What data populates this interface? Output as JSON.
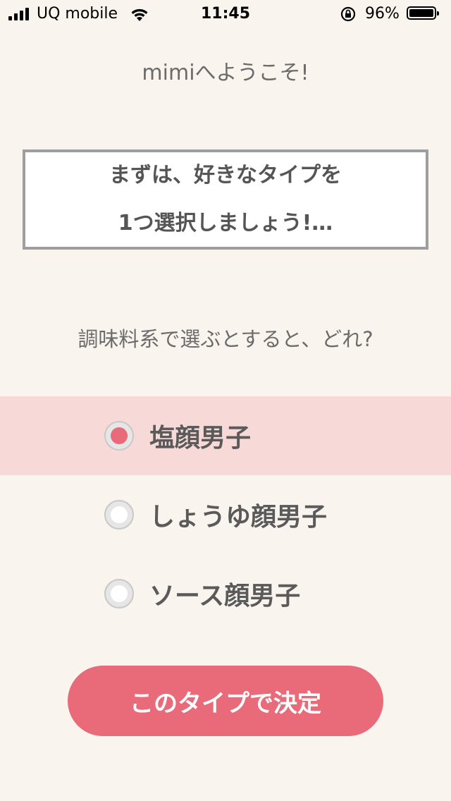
{
  "status_bar": {
    "carrier": "UQ mobile",
    "time": "11:45",
    "battery_percent": "96%",
    "icons": [
      "signal-icon",
      "wifi-icon",
      "rotation-lock-icon",
      "battery-icon"
    ]
  },
  "welcome_text": "mimiへようこそ!",
  "intro": {
    "line1": "まずは、好きなタイプを",
    "line2": "1つ選択しましょう!…"
  },
  "question": "調味料系で選ぶとすると、どれ?",
  "options": [
    {
      "label": "塩顔男子",
      "selected": true
    },
    {
      "label": "しょうゆ顔男子",
      "selected": false
    },
    {
      "label": "ソース顔男子",
      "selected": false
    }
  ],
  "confirm_button_label": "このタイプで決定",
  "colors": {
    "background": "#f9f4ee",
    "accent": "#e96a78",
    "selected_row": "#f7d9d8",
    "text": "#5a5a5a"
  }
}
